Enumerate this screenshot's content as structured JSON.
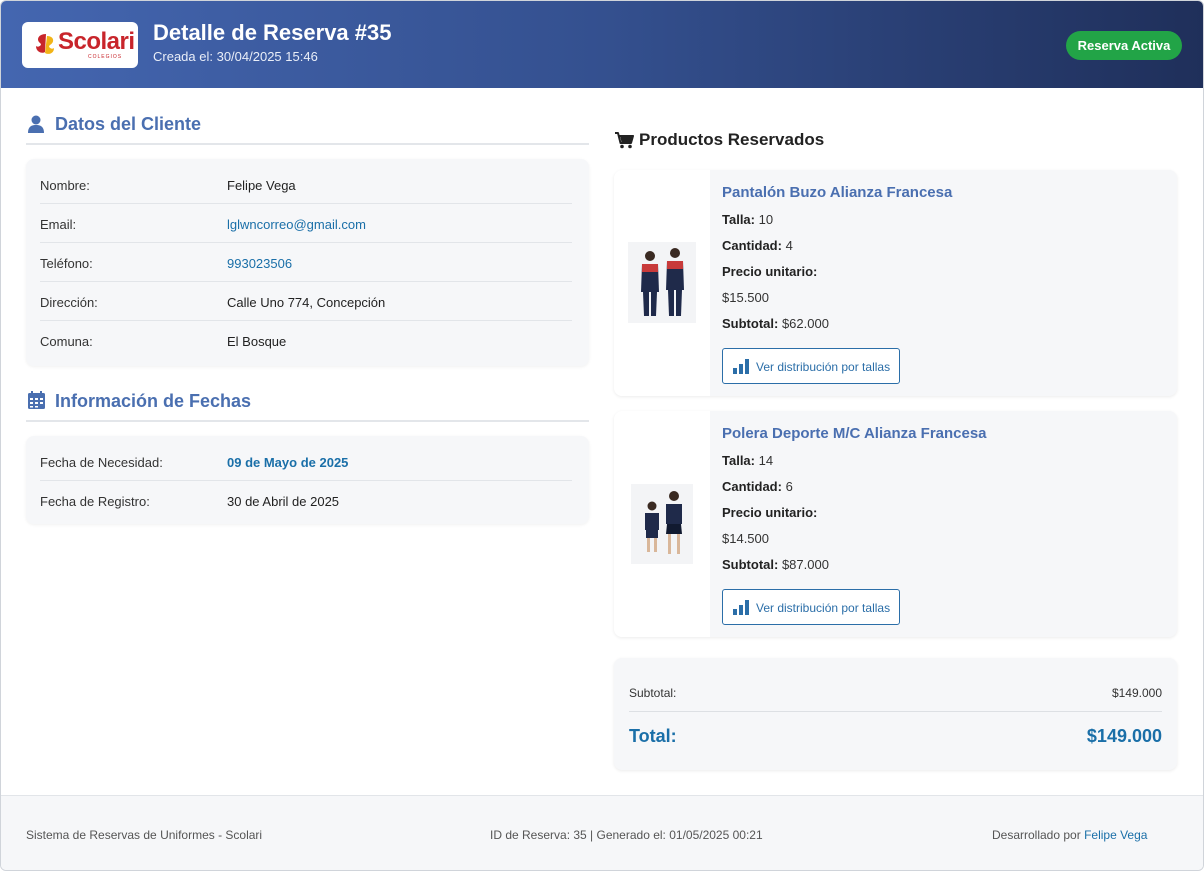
{
  "header": {
    "logo_text": "Scolari",
    "logo_sub": "COLEGIOS",
    "title": "Detalle de Reserva #35",
    "created": "Creada el: 30/04/2025 15:46",
    "status_badge": "Reserva Activa"
  },
  "client": {
    "section_title": "Datos del Cliente",
    "rows": [
      {
        "label": "Nombre:",
        "value": "Felipe Vega"
      },
      {
        "label": "Email:",
        "value": "lglwncorreo@gmail.com"
      },
      {
        "label": "Teléfono:",
        "value": "993023506"
      },
      {
        "label": "Dirección:",
        "value": "Calle Uno 774, Concepción"
      },
      {
        "label": "Comuna:",
        "value": "El Bosque"
      }
    ]
  },
  "dates": {
    "section_title": "Información de Fechas",
    "rows": [
      {
        "label": "Fecha de Necesidad:",
        "value": "09 de Mayo de 2025"
      },
      {
        "label": "Fecha de Registro:",
        "value": "30 de Abril de 2025"
      }
    ]
  },
  "products": {
    "section_title": "Productos Reservados",
    "items": [
      {
        "name": "Pantalón Buzo Alianza Francesa",
        "talla_label": "Talla:",
        "talla": "10",
        "cantidad_label": "Cantidad:",
        "cantidad": "4",
        "precio_label": "Precio unitario:",
        "precio": "$15.500",
        "subtotal_label": "Subtotal:",
        "subtotal": "$62.000",
        "button": "Ver distribución por tallas"
      },
      {
        "name": "Polera Deporte M/C Alianza Francesa",
        "talla_label": "Talla:",
        "talla": "14",
        "cantidad_label": "Cantidad:",
        "cantidad": "6",
        "precio_label": "Precio unitario:",
        "precio": "$14.500",
        "subtotal_label": "Subtotal:",
        "subtotal": "$87.000",
        "button": "Ver distribución por tallas"
      }
    ]
  },
  "totals": {
    "subtotal_label": "Subtotal:",
    "subtotal": "$149.000",
    "total_label": "Total:",
    "total": "$149.000"
  },
  "footer": {
    "left": "Sistema de Reservas de Uniformes - Scolari",
    "middle": "ID de Reserva: 35 | Generado el: 01/05/2025 00:21",
    "right_prefix": "Desarrollado por",
    "right_link": "Felipe Vega"
  },
  "colors": {
    "accent": "#4a6fb0",
    "link": "#1a6fa8",
    "badge": "#22a447",
    "brand_red": "#c8252b"
  },
  "icons": [
    "user-icon",
    "calendar-icon",
    "cart-icon",
    "bar-chart-icon"
  ]
}
